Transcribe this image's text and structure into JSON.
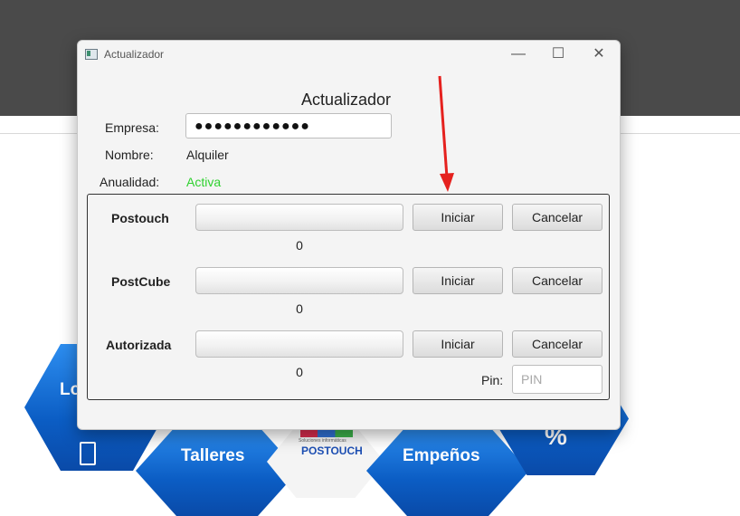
{
  "background": {
    "tiles": [
      {
        "label": "Lo"
      },
      {
        "label": "Talleres"
      },
      {
        "label": "Empeños"
      },
      {
        "label": "%"
      }
    ],
    "logo_text": "POSTOUCH",
    "logo_sub": "Soluciones informáticas"
  },
  "window": {
    "title": "Actualizador",
    "controls": {
      "minimize": "—",
      "maximize": "☐",
      "close": "✕"
    }
  },
  "form": {
    "heading": "Actualizador",
    "empresa_label": "Empresa:",
    "empresa_value": "●●●●●●●●●●●●",
    "nombre_label": "Nombre:",
    "nombre_value": "Alquiler",
    "anualidad_label": "Anualidad:",
    "anualidad_value": "Activa",
    "anualidad_color": "#2fd12f"
  },
  "updaters": [
    {
      "name": "Postouch",
      "count": "0",
      "start_label": "Iniciar",
      "cancel_label": "Cancelar"
    },
    {
      "name": "PostCube",
      "count": "0",
      "start_label": "Iniciar",
      "cancel_label": "Cancelar"
    },
    {
      "name": "Autorizada",
      "count": "0",
      "start_label": "Iniciar",
      "cancel_label": "Cancelar"
    }
  ],
  "pin": {
    "label": "Pin:",
    "placeholder": "PIN"
  },
  "annotation": {
    "arrow_color": "#e5211e"
  }
}
